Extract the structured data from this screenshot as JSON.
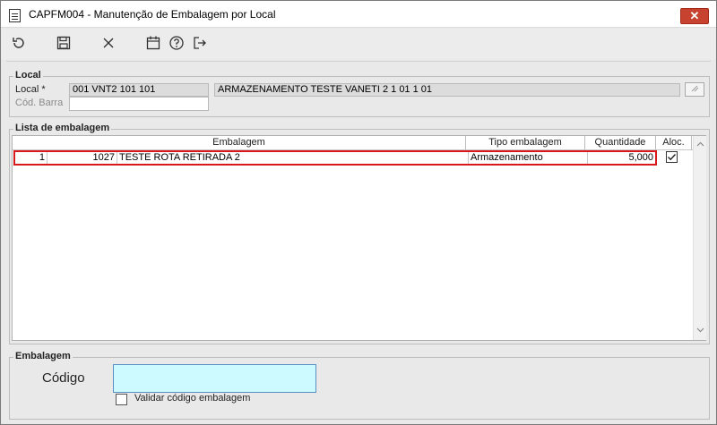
{
  "window": {
    "title": "CAPFM004 - Manutenção de Embalagem por Local",
    "close_glyph": "✕"
  },
  "toolbar": {
    "items": [
      {
        "name": "refresh-icon"
      },
      {
        "name": "save-icon"
      },
      {
        "name": "cancel-icon"
      },
      {
        "name": "calendar-icon"
      },
      {
        "name": "help-icon"
      },
      {
        "name": "exit-icon"
      }
    ]
  },
  "local": {
    "group_title": "Local",
    "local_label": "Local *",
    "local_code": "001 VNT2 101 101",
    "local_desc": "ARMAZENAMENTO TESTE VANETI 2 1 01 1 01",
    "barcode_label": "Cód. Barra",
    "barcode_value": ""
  },
  "list": {
    "group_title": "Lista de embalagem",
    "columns": {
      "embalagem": "Embalagem",
      "tipo": "Tipo embalagem",
      "quantidade": "Quantidade",
      "aloc": "Aloc."
    },
    "rows": [
      {
        "seq": "1",
        "code": "1027",
        "description": "TESTE ROTA RETIRADA 2",
        "tipo": "Armazenamento",
        "quantidade": "5,000",
        "aloc": true
      }
    ]
  },
  "embalagem": {
    "group_title": "Embalagem",
    "codigo_label": "Código",
    "codigo_value": "",
    "validar_label": "Validar código embalagem",
    "validar_checked": false
  }
}
